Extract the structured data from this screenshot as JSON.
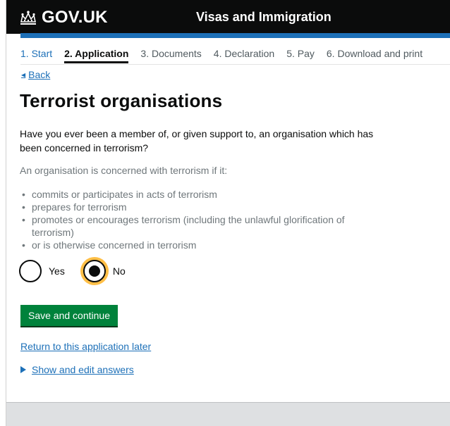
{
  "header": {
    "logo_text": "GOV.UK",
    "service_name": "Visas and Immigration",
    "background": "#0b0c0c",
    "accent": "#1d70b8"
  },
  "steps": [
    {
      "label": "1. Start",
      "state": "link"
    },
    {
      "label": "2. Application",
      "state": "current"
    },
    {
      "label": "3. Documents",
      "state": "inactive"
    },
    {
      "label": "4. Declaration",
      "state": "inactive"
    },
    {
      "label": "5. Pay",
      "state": "inactive"
    },
    {
      "label": "6. Download and print",
      "state": "inactive"
    }
  ],
  "back_label": "Back",
  "page_title": "Terrorist organisations",
  "question": "Have you ever been a member of, or given support to, an organisation which has been concerned in terrorism?",
  "hint": {
    "intro": "An organisation is concerned with terrorism if it:",
    "items": [
      "commits or participates in acts of terrorism",
      "prepares for terrorism",
      "promotes or encourages terrorism (including the unlawful glorification of terrorism)",
      "or is otherwise concerned in terrorism"
    ]
  },
  "radios": [
    {
      "label": "Yes",
      "checked": false
    },
    {
      "label": "No",
      "checked": true
    }
  ],
  "save_button_label": "Save and continue",
  "return_link_label": "Return to this application later",
  "details_label": "Show and edit answers",
  "colors": {
    "link": "#1d70b8",
    "button": "#00823b",
    "focus": "#ffbf47",
    "hint_text": "#6f777b"
  },
  "icons": {
    "logo": "crown-icon",
    "back": "back-arrow-icon",
    "details": "triangle-right-icon"
  }
}
